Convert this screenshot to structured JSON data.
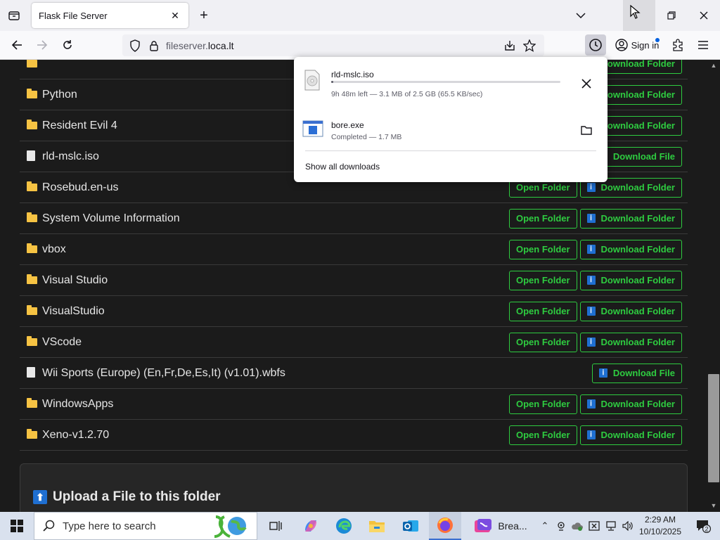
{
  "browser": {
    "tab_title": "Flask File Server",
    "url_host": "fileserver.",
    "url_domain": "loca.lt",
    "sign_in_label": "Sign in"
  },
  "downloads_panel": {
    "items": [
      {
        "name": "rld-mslc.iso",
        "status": "9h 48m left — 3.1 MB of 2.5 GB (65.5 KB/sec)",
        "progress": 0.0012,
        "action_icon": "close-icon"
      },
      {
        "name": "bore.exe",
        "status": "Completed — 1.7 MB",
        "action_icon": "folder-icon"
      }
    ],
    "show_all_label": "Show all downloads"
  },
  "file_list": {
    "open_label": "Open Folder",
    "download_folder_label": "Download Folder",
    "download_file_label": "Download File",
    "rows": [
      {
        "name": "",
        "type": "folder"
      },
      {
        "name": "Python",
        "type": "folder"
      },
      {
        "name": "Resident Evil 4",
        "type": "folder"
      },
      {
        "name": "rld-mslc.iso",
        "type": "file"
      },
      {
        "name": "Rosebud.en-us",
        "type": "folder"
      },
      {
        "name": "System Volume Information",
        "type": "folder"
      },
      {
        "name": "vbox",
        "type": "folder"
      },
      {
        "name": "Visual Studio",
        "type": "folder"
      },
      {
        "name": "VisualStudio",
        "type": "folder"
      },
      {
        "name": "VScode",
        "type": "folder"
      },
      {
        "name": "Wii Sports (Europe) (En,Fr,De,Es,It) (v1.01).wbfs",
        "type": "file"
      },
      {
        "name": "WindowsApps",
        "type": "folder"
      },
      {
        "name": "Xeno-v1.2.70",
        "type": "folder"
      }
    ]
  },
  "upload": {
    "title": "Upload a File to this folder"
  },
  "taskbar": {
    "search_placeholder": "Type here to search",
    "pinned_app_label": "Brea...",
    "time": "2:29 AM",
    "date": "10/10/2025",
    "notification_count": "2"
  },
  "colors": {
    "accent_green": "#2ecc40",
    "download_blue": "#1f6fd1",
    "folder_yellow": "#f6c343",
    "page_bg": "#1b1b1b"
  }
}
